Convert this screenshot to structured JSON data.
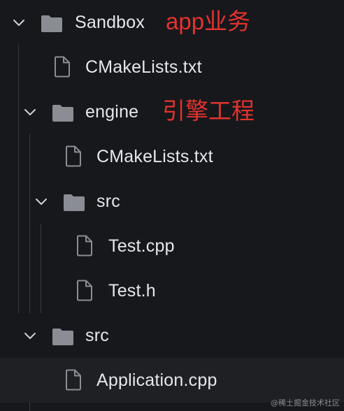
{
  "tree": {
    "root": {
      "label": "Sandbox",
      "note": "app业务"
    },
    "root_cmake": {
      "label": "CMakeLists.txt"
    },
    "engine": {
      "label": "engine",
      "note": "引擎工程"
    },
    "engine_cmake": {
      "label": "CMakeLists.txt"
    },
    "engine_src": {
      "label": "src"
    },
    "test_cpp": {
      "label": "Test.cpp"
    },
    "test_h": {
      "label": "Test.h"
    },
    "root_src": {
      "label": "src"
    },
    "application_cpp": {
      "label": "Application.cpp"
    }
  },
  "colors": {
    "background": "#17181c",
    "text": "#e6e7ea",
    "icon": "#8b8d95",
    "annotation": "#e3332e",
    "selected_row": "#1f2023",
    "guide_line": "#3a3b40"
  },
  "icons": {
    "expand": "chevron-down-icon",
    "folder": "folder-icon",
    "file": "file-icon"
  },
  "watermark": "@稀土掘金技术社区"
}
